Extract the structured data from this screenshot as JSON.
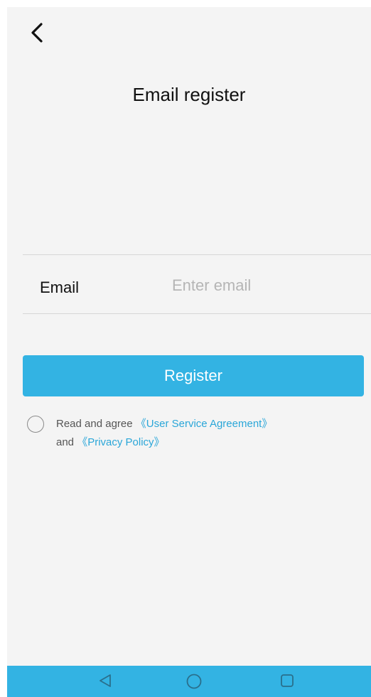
{
  "header": {
    "back_icon": "chevron-left-icon",
    "title": "Email register"
  },
  "form": {
    "email_label": "Email",
    "email_placeholder": "Enter email",
    "email_value": ""
  },
  "actions": {
    "register_label": "Register"
  },
  "agreement": {
    "checked": false,
    "prefix": "Read and agree ",
    "service_link": "《User Service Agreement》",
    "middle": "and ",
    "privacy_link": "《Privacy Policy》"
  },
  "nav_bar": {
    "back_icon": "triangle-back-icon",
    "home_icon": "circle-home-icon",
    "recents_icon": "square-recents-icon"
  },
  "colors": {
    "accent": "#33b3e3",
    "link": "#2aa6d8",
    "background": "#f4f4f4"
  }
}
